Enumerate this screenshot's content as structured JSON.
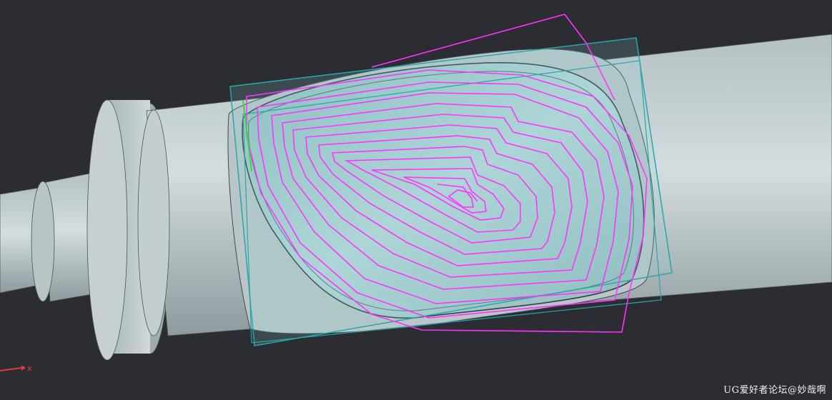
{
  "viewport": {
    "background": "#2b2d33",
    "part_color": "#c9d3d6",
    "pocket_color": "#a9cfd1",
    "bounding_box_color": "#2aa6a8",
    "toolpath_color": "#ff33ff",
    "toolpath_start_color": "#33dd33"
  },
  "triad": {
    "x_label": "x",
    "x_axis_color": "#e03a3a"
  },
  "watermark": {
    "text": "UG爱好者论坛@妙哉啊"
  }
}
